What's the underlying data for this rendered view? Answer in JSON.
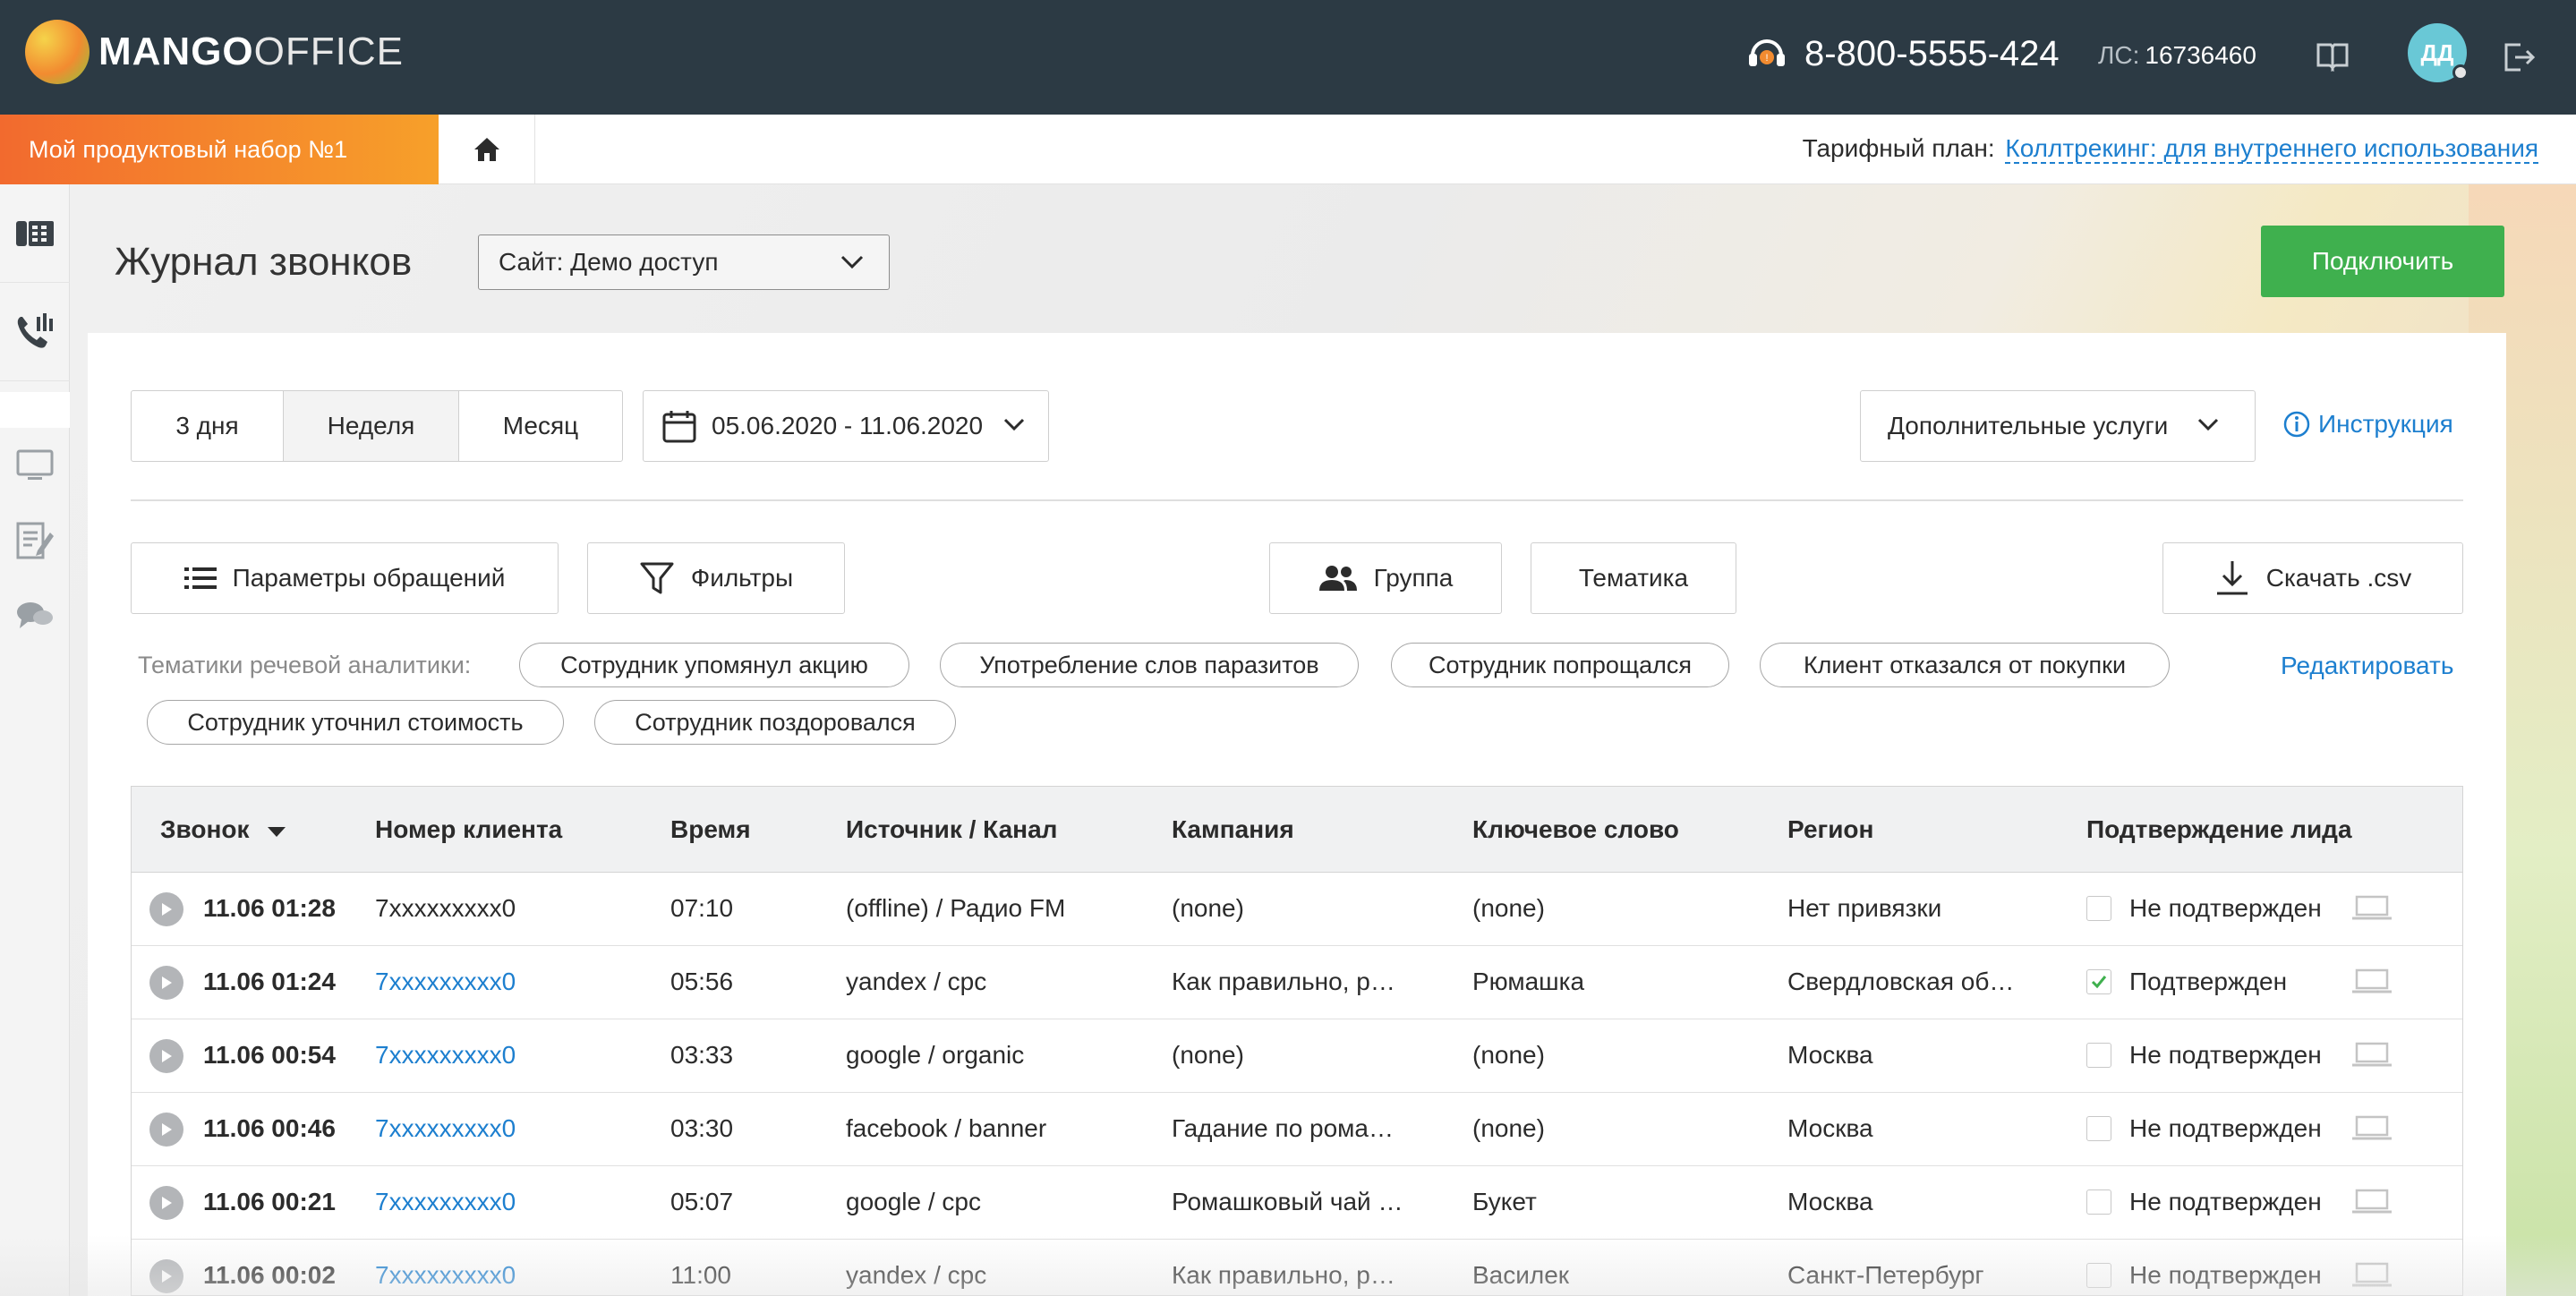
{
  "header": {
    "logo_bold": "MANGO",
    "logo_light": "OFFICE",
    "phone": "8-800-5555-424",
    "ls_label": "ЛС:",
    "ls_value": "16736460",
    "avatar_initials": "ДД"
  },
  "subbar": {
    "product": "Мой продуктовый набор №1",
    "tariff_label": "Тарифный план:",
    "tariff_value": "Коллтрекинг: для внутреннего использования"
  },
  "page": {
    "title": "Журнал звонков",
    "site_select": "Сайт: Демо доступ",
    "connect_button": "Подключить"
  },
  "period": {
    "options": [
      "3 дня",
      "Неделя",
      "Месяц"
    ],
    "selected": "Неделя",
    "date_range": "05.06.2020 - 11.06.2020"
  },
  "extra_services": "Дополнительные услуги",
  "instruction_link": "Инструкция",
  "toolbar": {
    "params": "Параметры обращений",
    "filters": "Фильтры",
    "group": "Группа",
    "theme": "Тематика",
    "download": "Скачать .csv"
  },
  "topics": {
    "label": "Тематики речевой аналитики:",
    "chips": [
      "Сотрудник упомянул акцию",
      "Употребление слов паразитов",
      "Сотрудник попрощался",
      "Клиент отказался от покупки",
      "Сотрудник уточнил стоимость",
      "Сотрудник поздоровался"
    ],
    "edit": "Редактировать"
  },
  "table": {
    "columns": [
      "Звонок",
      "Номер клиента",
      "Время",
      "Источник / Канал",
      "Кампания",
      "Ключевое слово",
      "Регион",
      "Подтверждение лида"
    ],
    "rows": [
      {
        "call": "11.06 01:28",
        "number": "7xxxxxxxxx0",
        "number_link": false,
        "time": "07:10",
        "source": "(offline) / Радио FM",
        "campaign": "(none)",
        "keyword": "(none)",
        "region": "Нет привязки",
        "confirmed": false,
        "status": "Не подтвержден"
      },
      {
        "call": "11.06 01:24",
        "number": "7xxxxxxxxx0",
        "number_link": true,
        "time": "05:56",
        "source": "yandex / cpc",
        "campaign": "Как правильно, р…",
        "keyword": "Рюмашка",
        "region": "Свердловская об…",
        "confirmed": true,
        "status": "Подтвержден"
      },
      {
        "call": "11.06 00:54",
        "number": "7xxxxxxxxx0",
        "number_link": true,
        "time": "03:33",
        "source": "google / organic",
        "campaign": "(none)",
        "keyword": "(none)",
        "region": "Москва",
        "confirmed": false,
        "status": "Не подтвержден"
      },
      {
        "call": "11.06 00:46",
        "number": "7xxxxxxxxx0",
        "number_link": true,
        "time": "03:30",
        "source": "facebook / banner",
        "campaign": "Гадание по рома…",
        "keyword": "(none)",
        "region": "Москва",
        "confirmed": false,
        "status": "Не подтвержден"
      },
      {
        "call": "11.06 00:21",
        "number": "7xxxxxxxxx0",
        "number_link": true,
        "time": "05:07",
        "source": "google / cpc",
        "campaign": "Ромашковый чай …",
        "keyword": "Букет",
        "region": "Москва",
        "confirmed": false,
        "status": "Не подтвержден"
      },
      {
        "call": "11.06 00:02",
        "number": "7xxxxxxxxx0",
        "number_link": true,
        "time": "11:00",
        "source": "yandex / cpc",
        "campaign": "Как правильно, р…",
        "keyword": "Василек",
        "region": "Санкт-Петербург",
        "confirmed": false,
        "status": "Не подтвержден"
      }
    ]
  },
  "colors": {
    "topbar": "#2c3a44",
    "accent_orange": "#f26a2e",
    "link_blue": "#1d7fcf",
    "connect_green": "#3fb04e"
  }
}
